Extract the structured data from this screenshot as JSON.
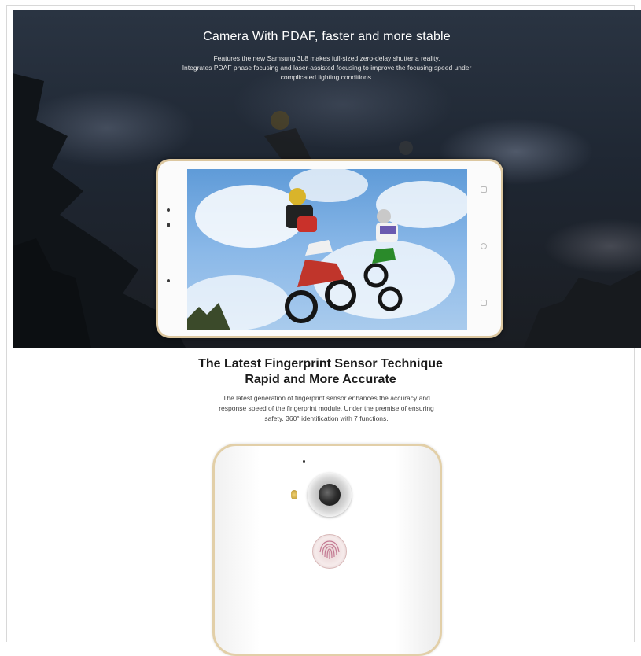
{
  "hero": {
    "title": "Camera With PDAF, faster and more stable",
    "lines": [
      "Features the new Samsung 3L8 makes full-sized zero-delay shutter a reality.",
      "Integrates PDAF phase focusing and laser-assisted focusing to improve the focusing speed under",
      "complicated lighting conditions."
    ]
  },
  "fingerprint": {
    "title_lines": [
      "The Latest Fingerprint Sensor Technique",
      "Rapid and More Accurate"
    ],
    "text_lines": [
      "The latest generation of fingerprint sensor enhances the accuracy and",
      "response speed of the fingerprint module. Under the premise of ensuring",
      "safety. 360° identification with 7 functions."
    ]
  },
  "colors": {
    "gold_trim": "#dcc7a0",
    "hero_bg": "#1f2733",
    "sky": "#8ab8e8"
  }
}
